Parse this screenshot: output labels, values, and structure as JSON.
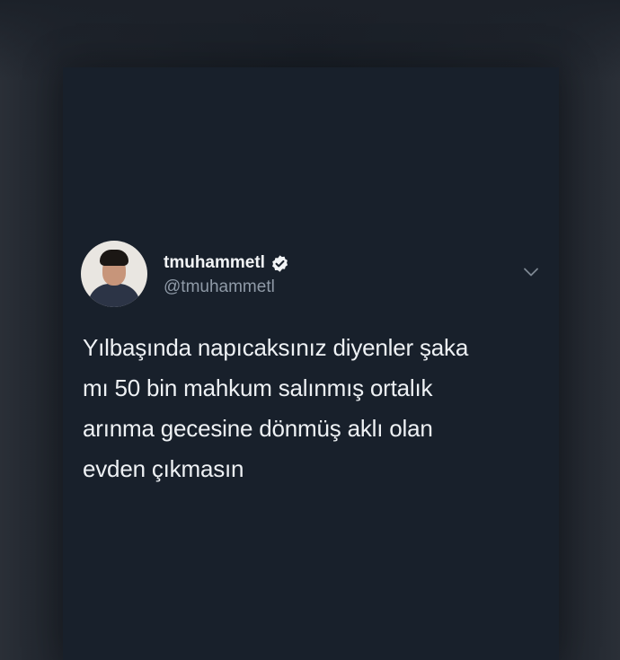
{
  "tweet": {
    "display_name": "tmuhammetl",
    "handle": "@tmuhammetl",
    "verified": true,
    "text_lines": [
      "Yılbaşında napıcaksınız diyenler şaka",
      "mı 50 bin mahkum salınmış ortalık",
      "arınma gecesine dönmüş aklı olan",
      "evden çıkmasın"
    ]
  },
  "icons": {
    "verified": "verified-badge-icon",
    "menu": "chevron-down-icon"
  },
  "colors": {
    "background": "#1a1f27",
    "card": "#18202b",
    "text": "#eef1f4",
    "handle": "#8f9aa7"
  }
}
